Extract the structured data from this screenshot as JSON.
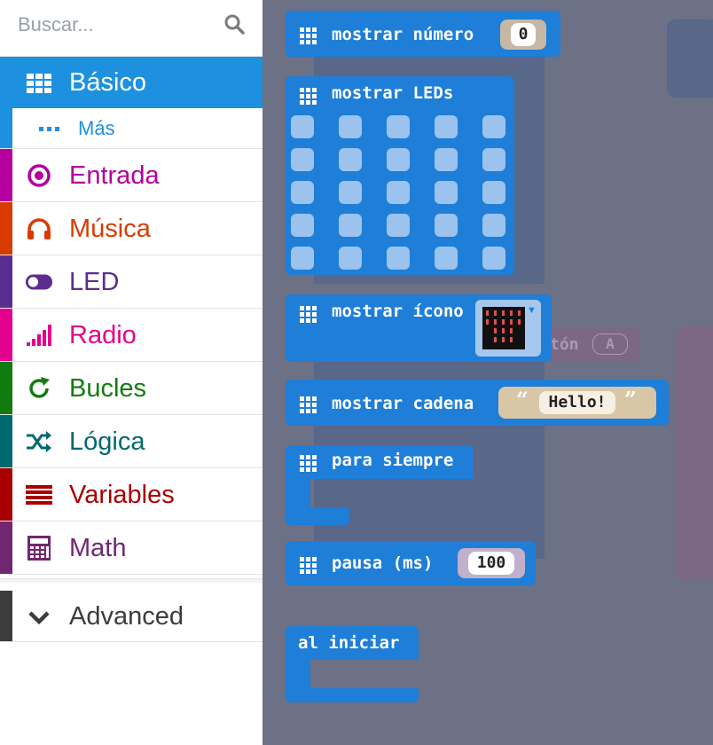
{
  "search": {
    "placeholder": "Buscar..."
  },
  "sidebar": {
    "basico": "Básico",
    "mas": "Más",
    "items": [
      {
        "label": "Entrada",
        "color": "#b4009e",
        "icon": "target-icon"
      },
      {
        "label": "Música",
        "color": "#d83b01",
        "icon": "headphones-icon"
      },
      {
        "label": "LED",
        "color": "#5c2d91",
        "icon": "toggle-icon"
      },
      {
        "label": "Radio",
        "color": "#e3008c",
        "icon": "signal-icon"
      },
      {
        "label": "Bucles",
        "color": "#107c10",
        "icon": "refresh-icon"
      },
      {
        "label": "Lógica",
        "color": "#006970",
        "icon": "shuffle-icon"
      },
      {
        "label": "Variables",
        "color": "#a80000",
        "icon": "list-icon"
      },
      {
        "label": "Math",
        "color": "#712672",
        "icon": "calculator-icon"
      }
    ],
    "advanced": "Advanced"
  },
  "blocks": {
    "show_number": "mostrar número",
    "show_number_value": "0",
    "show_leds": "mostrar LEDs",
    "show_icon": "mostrar ícono",
    "show_string": "mostrar cadena",
    "show_string_value": "Hello!",
    "forever": "para siempre",
    "pause": "pausa (ms)",
    "pause_value": "100",
    "on_start": "al iniciar"
  },
  "ghost": {
    "button_text": "tón",
    "button_value": "A"
  }
}
